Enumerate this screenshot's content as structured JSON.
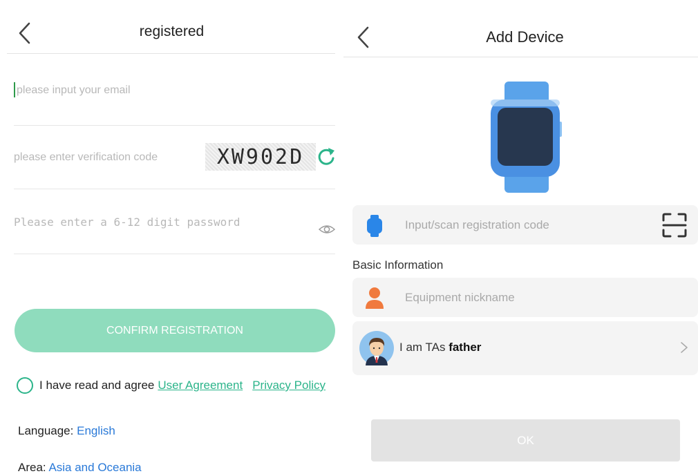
{
  "left": {
    "title": "registered",
    "email": {
      "value": "",
      "placeholder": "please input your email"
    },
    "code": {
      "value": "",
      "placeholder": "please enter verification code"
    },
    "captcha": "XW902D",
    "password": {
      "value": "",
      "placeholder": "Please enter a 6-12 digit password"
    },
    "confirm_label": "CONFIRM REGISTRATION",
    "agreement": {
      "checked": false,
      "text": "I have read and agree",
      "user_agreement": "User Agreement",
      "privacy_policy": "Privacy Policy"
    },
    "language": {
      "label": "Language:",
      "value": "English"
    },
    "area": {
      "label": "Area:",
      "value": "Asia and Oceania"
    }
  },
  "right": {
    "title": "Add Device",
    "registration_code": {
      "value": "",
      "placeholder": "Input/scan registration code"
    },
    "basic_info_label": "Basic Information",
    "nickname": {
      "value": "",
      "placeholder": "Equipment nickname"
    },
    "relation": {
      "prefix": "I am TAs",
      "value": "father"
    },
    "ok_label": "OK"
  },
  "icons": {
    "back": "chevron-left-icon",
    "refresh": "refresh-icon",
    "eye": "eye-icon",
    "watch": "smartwatch-icon",
    "scan": "scan-frame-icon",
    "person": "person-icon",
    "avatar": "father-avatar",
    "chevron": "chevron-right-icon"
  },
  "colors": {
    "accent_green": "#2bb48a",
    "confirm_button": "#8fdcbd",
    "link_blue": "#2979d8",
    "watch_blue": "#4a90e2",
    "person_orange": "#f07a3e",
    "ok_disabled": "#e3e3e3"
  }
}
